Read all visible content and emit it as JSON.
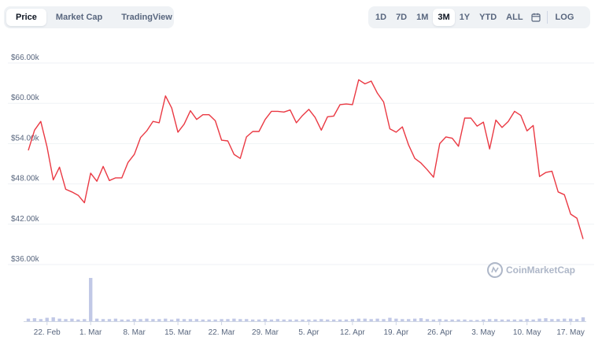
{
  "tabs_left": [
    {
      "label": "Price",
      "active": true
    },
    {
      "label": "Market Cap",
      "active": false
    },
    {
      "label": "TradingView",
      "active": false
    }
  ],
  "tabs_right": [
    {
      "label": "1D",
      "active": false
    },
    {
      "label": "7D",
      "active": false
    },
    {
      "label": "1M",
      "active": false
    },
    {
      "label": "3M",
      "active": true
    },
    {
      "label": "1Y",
      "active": false
    },
    {
      "label": "YTD",
      "active": false
    },
    {
      "label": "ALL",
      "active": false
    }
  ],
  "calendar_icon": "calendar-icon",
  "log_label": "LOG",
  "watermark": "CoinMarketCap",
  "colors": {
    "line": "#ea3943",
    "volume": "#c1c8e6",
    "grid": "#eff2f5",
    "tab_bg": "#eff2f5"
  },
  "chart_data": {
    "type": "line",
    "title": "",
    "xlabel": "",
    "ylabel": "",
    "ylim": [
      36000,
      66000
    ],
    "yticks": [
      36000,
      42000,
      48000,
      54000,
      60000,
      66000
    ],
    "ytick_labels": [
      "$36.00k",
      "$42.00k",
      "$48.00k",
      "$54.00k",
      "$60.00k",
      "$66.00k"
    ],
    "xlim": [
      "2021-02-19",
      "2021-05-19"
    ],
    "xticks": [
      "2021-02-22",
      "2021-03-01",
      "2021-03-08",
      "2021-03-15",
      "2021-03-22",
      "2021-03-29",
      "2021-04-05",
      "2021-04-12",
      "2021-04-19",
      "2021-04-26",
      "2021-05-03",
      "2021-05-10",
      "2021-05-17"
    ],
    "xtick_labels": [
      "22. Feb",
      "1. Mar",
      "8. Mar",
      "15. Mar",
      "22. Mar",
      "29. Mar",
      "5. Apr",
      "12. Apr",
      "19. Apr",
      "26. Apr",
      "3. May",
      "10. May",
      "17. May"
    ],
    "grid": true,
    "series": [
      {
        "values": [
          [
            "2021-02-19",
            53000
          ],
          [
            "2021-02-20",
            56000
          ],
          [
            "2021-02-21",
            57300
          ],
          [
            "2021-02-22",
            53500
          ],
          [
            "2021-02-23",
            48600
          ],
          [
            "2021-02-24",
            50500
          ],
          [
            "2021-02-25",
            47200
          ],
          [
            "2021-02-26",
            46800
          ],
          [
            "2021-02-27",
            46300
          ],
          [
            "2021-02-28",
            45200
          ],
          [
            "2021-03-01",
            49600
          ],
          [
            "2021-03-02",
            48400
          ],
          [
            "2021-03-03",
            50600
          ],
          [
            "2021-03-04",
            48500
          ],
          [
            "2021-03-05",
            48900
          ],
          [
            "2021-03-06",
            48900
          ],
          [
            "2021-03-07",
            51200
          ],
          [
            "2021-03-08",
            52400
          ],
          [
            "2021-03-09",
            54900
          ],
          [
            "2021-03-10",
            55900
          ],
          [
            "2021-03-11",
            57300
          ],
          [
            "2021-03-12",
            57100
          ],
          [
            "2021-03-13",
            61100
          ],
          [
            "2021-03-14",
            59300
          ],
          [
            "2021-03-15",
            55700
          ],
          [
            "2021-03-16",
            56900
          ],
          [
            "2021-03-17",
            58900
          ],
          [
            "2021-03-18",
            57600
          ],
          [
            "2021-03-19",
            58300
          ],
          [
            "2021-03-20",
            58300
          ],
          [
            "2021-03-21",
            57400
          ],
          [
            "2021-03-22",
            54500
          ],
          [
            "2021-03-23",
            54400
          ],
          [
            "2021-03-24",
            52400
          ],
          [
            "2021-03-25",
            51800
          ],
          [
            "2021-03-26",
            55000
          ],
          [
            "2021-03-27",
            55800
          ],
          [
            "2021-03-28",
            55800
          ],
          [
            "2021-03-29",
            57600
          ],
          [
            "2021-03-30",
            58800
          ],
          [
            "2021-03-31",
            58800
          ],
          [
            "2021-04-01",
            58700
          ],
          [
            "2021-04-02",
            59000
          ],
          [
            "2021-04-03",
            57100
          ],
          [
            "2021-04-04",
            58200
          ],
          [
            "2021-04-05",
            59100
          ],
          [
            "2021-04-06",
            57900
          ],
          [
            "2021-04-07",
            56000
          ],
          [
            "2021-04-08",
            58000
          ],
          [
            "2021-04-09",
            58100
          ],
          [
            "2021-04-10",
            59800
          ],
          [
            "2021-04-11",
            59900
          ],
          [
            "2021-04-12",
            59800
          ],
          [
            "2021-04-13",
            63500
          ],
          [
            "2021-04-14",
            62900
          ],
          [
            "2021-04-15",
            63300
          ],
          [
            "2021-04-16",
            61500
          ],
          [
            "2021-04-17",
            60200
          ],
          [
            "2021-04-18",
            56200
          ],
          [
            "2021-04-19",
            55700
          ],
          [
            "2021-04-20",
            56500
          ],
          [
            "2021-04-21",
            53800
          ],
          [
            "2021-04-22",
            51800
          ],
          [
            "2021-04-23",
            51100
          ],
          [
            "2021-04-24",
            50100
          ],
          [
            "2021-04-25",
            49000
          ],
          [
            "2021-04-26",
            54000
          ],
          [
            "2021-04-27",
            55000
          ],
          [
            "2021-04-28",
            54800
          ],
          [
            "2021-04-29",
            53600
          ],
          [
            "2021-04-30",
            57800
          ],
          [
            "2021-05-01",
            57800
          ],
          [
            "2021-05-02",
            56600
          ],
          [
            "2021-05-03",
            57200
          ],
          [
            "2021-05-04",
            53200
          ],
          [
            "2021-05-05",
            57500
          ],
          [
            "2021-05-06",
            56400
          ],
          [
            "2021-05-07",
            57300
          ],
          [
            "2021-05-08",
            58800
          ],
          [
            "2021-05-09",
            58200
          ],
          [
            "2021-05-10",
            55900
          ],
          [
            "2021-05-11",
            56700
          ],
          [
            "2021-05-12",
            49100
          ],
          [
            "2021-05-13",
            49700
          ],
          [
            "2021-05-14",
            49900
          ],
          [
            "2021-05-15",
            46800
          ],
          [
            "2021-05-16",
            46400
          ],
          [
            "2021-05-17",
            43500
          ],
          [
            "2021-05-18",
            42900
          ],
          [
            "2021-05-19",
            39800
          ]
        ]
      }
    ],
    "volume": [
      [
        "2021-02-19",
        0.06
      ],
      [
        "2021-02-20",
        0.07
      ],
      [
        "2021-02-21",
        0.05
      ],
      [
        "2021-02-22",
        0.08
      ],
      [
        "2021-02-23",
        0.09
      ],
      [
        "2021-02-24",
        0.06
      ],
      [
        "2021-02-25",
        0.05
      ],
      [
        "2021-02-26",
        0.06
      ],
      [
        "2021-02-27",
        0.04
      ],
      [
        "2021-02-28",
        0.05
      ],
      [
        "2021-03-01",
        1.0
      ],
      [
        "2021-03-02",
        0.06
      ],
      [
        "2021-03-03",
        0.05
      ],
      [
        "2021-03-04",
        0.05
      ],
      [
        "2021-03-05",
        0.06
      ],
      [
        "2021-03-06",
        0.04
      ],
      [
        "2021-03-07",
        0.04
      ],
      [
        "2021-03-08",
        0.05
      ],
      [
        "2021-03-09",
        0.05
      ],
      [
        "2021-03-10",
        0.06
      ],
      [
        "2021-03-11",
        0.05
      ],
      [
        "2021-03-12",
        0.05
      ],
      [
        "2021-03-13",
        0.06
      ],
      [
        "2021-03-14",
        0.04
      ],
      [
        "2021-03-15",
        0.06
      ],
      [
        "2021-03-16",
        0.05
      ],
      [
        "2021-03-17",
        0.05
      ],
      [
        "2021-03-18",
        0.05
      ],
      [
        "2021-03-19",
        0.04
      ],
      [
        "2021-03-20",
        0.04
      ],
      [
        "2021-03-21",
        0.04
      ],
      [
        "2021-03-22",
        0.05
      ],
      [
        "2021-03-23",
        0.05
      ],
      [
        "2021-03-24",
        0.06
      ],
      [
        "2021-03-25",
        0.05
      ],
      [
        "2021-03-26",
        0.05
      ],
      [
        "2021-03-27",
        0.04
      ],
      [
        "2021-03-28",
        0.04
      ],
      [
        "2021-03-29",
        0.05
      ],
      [
        "2021-03-30",
        0.04
      ],
      [
        "2021-03-31",
        0.05
      ],
      [
        "2021-04-01",
        0.04
      ],
      [
        "2021-04-02",
        0.04
      ],
      [
        "2021-04-03",
        0.04
      ],
      [
        "2021-04-04",
        0.04
      ],
      [
        "2021-04-05",
        0.04
      ],
      [
        "2021-04-06",
        0.04
      ],
      [
        "2021-04-07",
        0.05
      ],
      [
        "2021-04-08",
        0.04
      ],
      [
        "2021-04-09",
        0.04
      ],
      [
        "2021-04-10",
        0.04
      ],
      [
        "2021-04-11",
        0.04
      ],
      [
        "2021-04-12",
        0.05
      ],
      [
        "2021-04-13",
        0.06
      ],
      [
        "2021-04-14",
        0.06
      ],
      [
        "2021-04-15",
        0.05
      ],
      [
        "2021-04-16",
        0.06
      ],
      [
        "2021-04-17",
        0.05
      ],
      [
        "2021-04-18",
        0.08
      ],
      [
        "2021-04-19",
        0.06
      ],
      [
        "2021-04-20",
        0.05
      ],
      [
        "2021-04-21",
        0.05
      ],
      [
        "2021-04-22",
        0.06
      ],
      [
        "2021-04-23",
        0.07
      ],
      [
        "2021-04-24",
        0.05
      ],
      [
        "2021-04-25",
        0.04
      ],
      [
        "2021-04-26",
        0.05
      ],
      [
        "2021-04-27",
        0.04
      ],
      [
        "2021-04-28",
        0.04
      ],
      [
        "2021-04-29",
        0.04
      ],
      [
        "2021-04-30",
        0.04
      ],
      [
        "2021-05-01",
        0.03
      ],
      [
        "2021-05-02",
        0.03
      ],
      [
        "2021-05-03",
        0.04
      ],
      [
        "2021-05-04",
        0.05
      ],
      [
        "2021-05-05",
        0.05
      ],
      [
        "2021-05-06",
        0.04
      ],
      [
        "2021-05-07",
        0.04
      ],
      [
        "2021-05-08",
        0.04
      ],
      [
        "2021-05-09",
        0.04
      ],
      [
        "2021-05-10",
        0.05
      ],
      [
        "2021-05-11",
        0.04
      ],
      [
        "2021-05-12",
        0.06
      ],
      [
        "2021-05-13",
        0.07
      ],
      [
        "2021-05-14",
        0.05
      ],
      [
        "2021-05-15",
        0.05
      ],
      [
        "2021-05-16",
        0.06
      ],
      [
        "2021-05-17",
        0.06
      ],
      [
        "2021-05-18",
        0.05
      ],
      [
        "2021-05-19",
        0.09
      ]
    ]
  }
}
